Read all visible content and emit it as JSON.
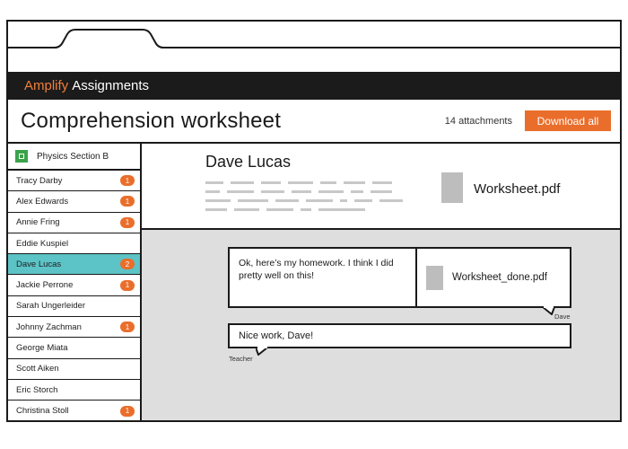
{
  "app": {
    "brand": "Amplify",
    "name": "Assignments"
  },
  "header": {
    "title": "Comprehension worksheet",
    "attachments_label": "14 attachments",
    "download_label": "Download all"
  },
  "sidebar": {
    "section": {
      "label": "Physics Section B",
      "icon": "section-square-icon",
      "color": "#3aa34a"
    },
    "students": [
      {
        "name": "Tracy Darby",
        "count": "1"
      },
      {
        "name": "Alex Edwards",
        "count": "1"
      },
      {
        "name": "Annie Fring",
        "count": "1"
      },
      {
        "name": "Eddie Kuspiel",
        "count": ""
      },
      {
        "name": "Dave Lucas",
        "count": "2",
        "selected": true
      },
      {
        "name": "Jackie Perrone",
        "count": "1"
      },
      {
        "name": "Sarah Ungerleider",
        "count": ""
      },
      {
        "name": "Johnny Zachman",
        "count": "1"
      },
      {
        "name": "George Miata",
        "count": ""
      },
      {
        "name": "Scott Aiken",
        "count": ""
      },
      {
        "name": "Eric Storch",
        "count": ""
      },
      {
        "name": "Christina Stoll",
        "count": "1"
      }
    ]
  },
  "detail": {
    "student_name": "Dave Lucas",
    "attachment": {
      "file_name": "Worksheet.pdf",
      "icon": "document-thumbnail-icon"
    }
  },
  "thread": {
    "messages": [
      {
        "text": "Ok, here’s my homework. I think I did pretty well on this!",
        "attachment": "Worksheet_done.pdf",
        "author": "Dave"
      },
      {
        "text": "Nice work, Dave!",
        "author": "Teacher"
      }
    ]
  },
  "colors": {
    "accent": "#ea6e2b",
    "brand": "#f07f3c",
    "selected_row": "#5cc3c6",
    "appbar": "#1b1b1b",
    "thread_background": "#dedede"
  }
}
